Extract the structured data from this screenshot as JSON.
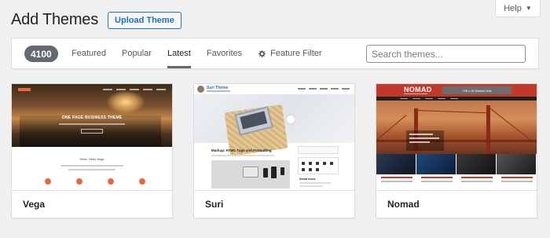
{
  "header": {
    "title": "Add Themes",
    "upload_label": "Upload Theme",
    "help_label": "Help"
  },
  "filter": {
    "count": "4100",
    "tabs": [
      {
        "label": "Featured",
        "active": false
      },
      {
        "label": "Popular",
        "active": false
      },
      {
        "label": "Latest",
        "active": true
      },
      {
        "label": "Favorites",
        "active": false
      },
      {
        "label": "Feature Filter",
        "active": false,
        "icon": "gear-icon"
      }
    ],
    "search_placeholder": "Search themes..."
  },
  "themes": [
    {
      "name": "Vega",
      "preview": {
        "hero_text": "ONE PAGE BUSINESS THEME",
        "section_title": "Hello. Hello Vega",
        "accent": "#e96743"
      }
    },
    {
      "name": "Suri",
      "preview": {
        "site_title": "Suri Theme",
        "post_title": "Markup: HTML Tags and Formatting",
        "sidebar_title": "Social Icons",
        "accent": "#2a6bb3"
      }
    },
    {
      "name": "Nomad",
      "preview": {
        "logo": "NOMAD",
        "ad_text": "728 x 90 Banner Ads",
        "accent": "#c0392b"
      }
    }
  ],
  "colors": {
    "page_bg": "#f0f0f1",
    "link_blue": "#2271b1",
    "badge_gray": "#646970"
  }
}
